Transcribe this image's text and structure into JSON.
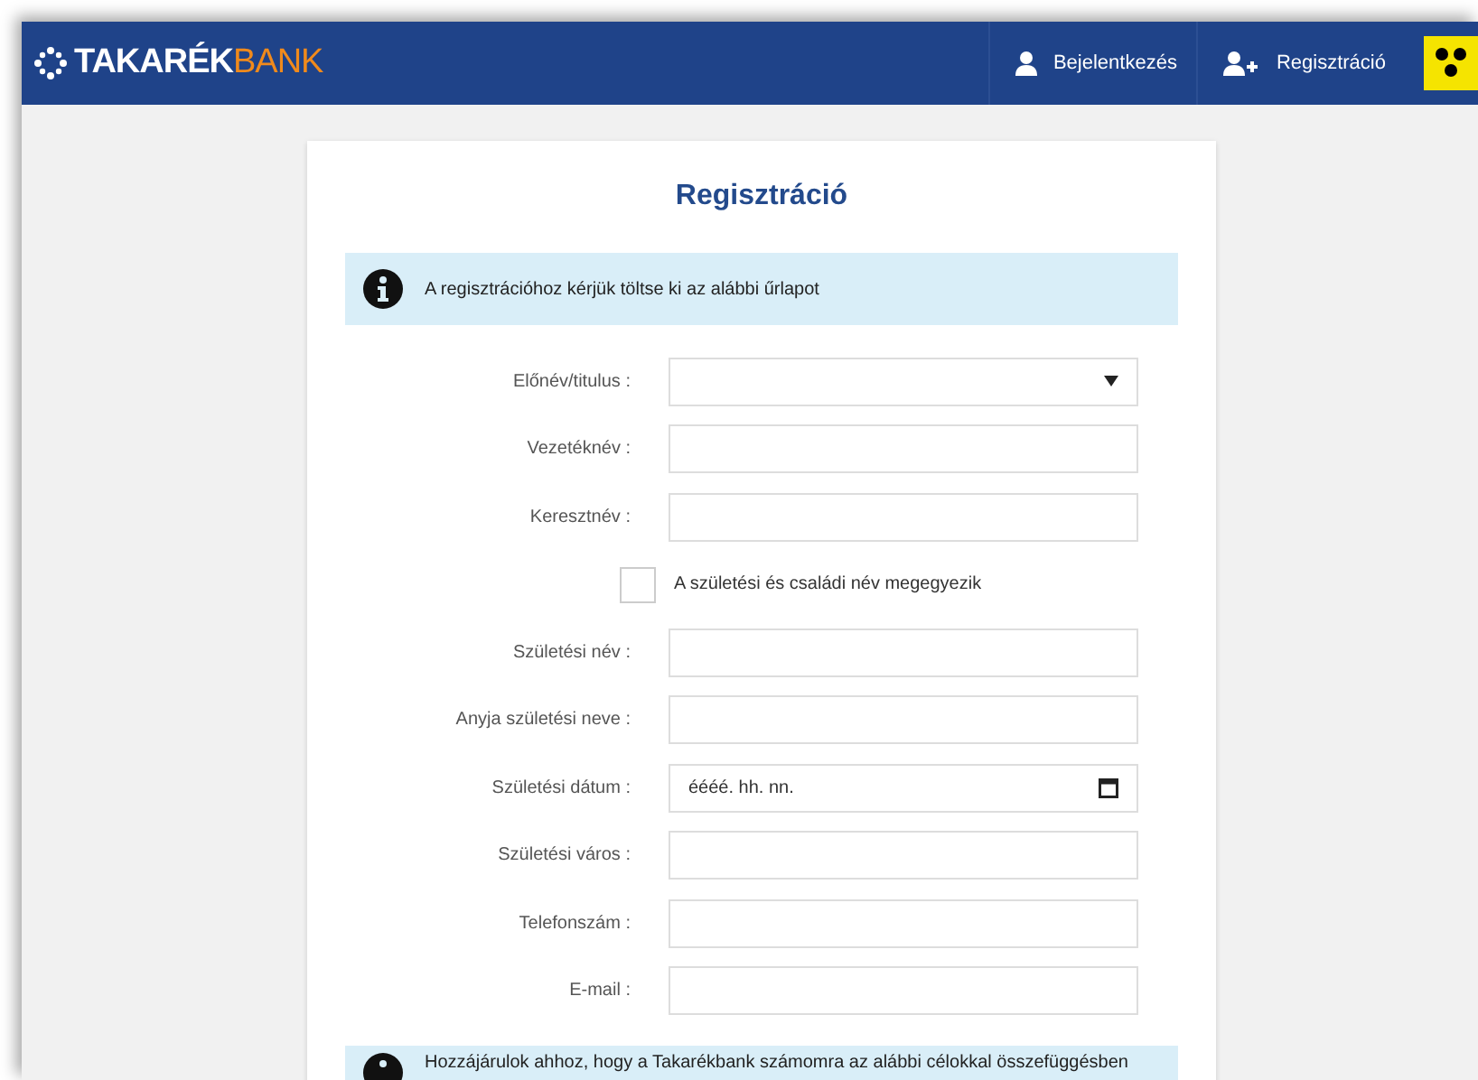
{
  "header": {
    "logo": {
      "part_1": "TAKARÉK",
      "part_2": "BANK"
    },
    "nav": [
      {
        "label": "Bejelentkezés",
        "kind": "user"
      },
      {
        "label": "Regisztráció",
        "kind": "user-plus"
      }
    ]
  },
  "card": {
    "title": "Regisztráció",
    "info": "A regisztrációhoz kérjük töltse ki az alábbi űrlapot",
    "rows": [
      {
        "kind": "select",
        "label": "Előnév/titulus :"
      },
      {
        "kind": "text",
        "label": "Vezetéknév :"
      },
      {
        "kind": "text",
        "label": "Keresztnév :"
      },
      {
        "kind": "checkbox",
        "label": "A születési és családi név megegyezik",
        "checked": false
      },
      {
        "kind": "text",
        "label": "Születési név :"
      },
      {
        "kind": "text",
        "label": "Anyja születési neve :"
      },
      {
        "kind": "date",
        "label": "Születési dátum :",
        "placeholder": "éééé. hh. nn."
      },
      {
        "kind": "text",
        "label": "Születési város :"
      },
      {
        "kind": "text",
        "label": "Telefonszám :"
      },
      {
        "kind": "text",
        "label": "E-mail :"
      }
    ],
    "consent": "Hozzájárulok ahhoz, hogy a Takarékbank számomra az alábbi célokkal összefüggésben"
  }
}
